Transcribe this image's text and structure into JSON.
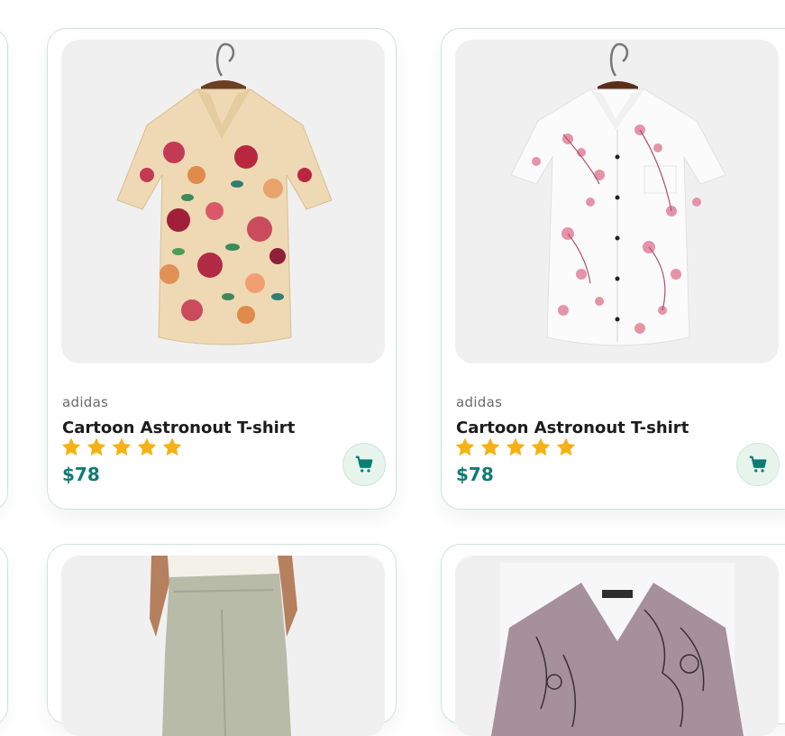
{
  "products": [
    {
      "brand": "adidas",
      "name": "Cartoon Astronout T-shirt",
      "price": "$78",
      "rating": 5,
      "image": "floral beige hawaiian shirt on hanger"
    },
    {
      "brand": "adidas",
      "name": "Cartoon Astronout T-shirt",
      "price": "$78",
      "rating": 5,
      "image": "white shirt with pink blossom print on hanger"
    },
    {
      "image": "model wearing white top and khaki trousers"
    },
    {
      "image": "mauve printed v-neck top"
    }
  ],
  "colors": {
    "accent": "#0d7c73",
    "star": "#f5b212",
    "cart_bg": "#e6f4ec",
    "image_bg": "#f0f0f0"
  },
  "icons": {
    "cart": "shopping-cart-icon",
    "star": "star-icon"
  }
}
